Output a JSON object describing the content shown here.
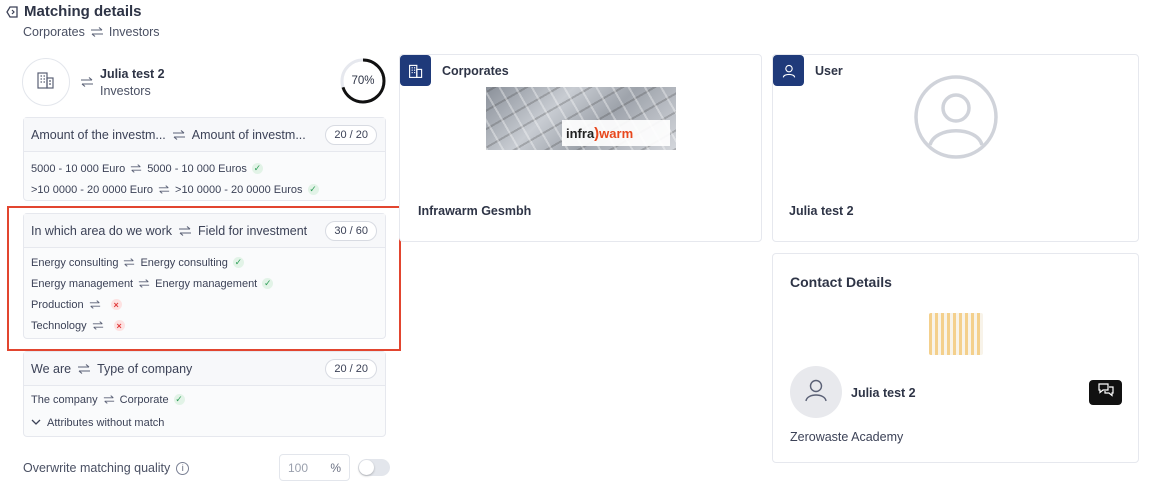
{
  "header": {
    "title": "Matching details",
    "from": "Corporates",
    "to": "Investors"
  },
  "match": {
    "name": "Julia test 2",
    "type": "Investors",
    "score": "70%",
    "score_fraction": 0.7
  },
  "sections": [
    {
      "left": "Amount of the investm...",
      "right": "Amount of investm...",
      "score": "20 / 20",
      "rows": [
        {
          "left": "5000 - 10 000 Euro",
          "right": "5000 - 10 000 Euros",
          "status": "match"
        },
        {
          "left": ">10 0000 - 20 0000 Euro",
          "right": ">10 0000 - 20 0000 Euros",
          "status": "match"
        }
      ]
    },
    {
      "left": "In which area do we work",
      "right": "Field for investment",
      "score": "30 / 60",
      "rows": [
        {
          "left": "Energy consulting",
          "right": "Energy consulting",
          "status": "match"
        },
        {
          "left": "Energy management",
          "right": "Energy management",
          "status": "match"
        },
        {
          "left": "Production",
          "right": "",
          "status": "nomatch"
        },
        {
          "left": "Technology",
          "right": "",
          "status": "nomatch"
        }
      ]
    },
    {
      "left": "We are",
      "right": "Type of company",
      "score": "20 / 20",
      "rows": [
        {
          "left": "The company",
          "right": "Corporate",
          "status": "match"
        }
      ],
      "expander": "Attributes without match"
    }
  ],
  "overwrite": {
    "label": "Overwrite matching quality",
    "placeholder": "100",
    "unit": "%"
  },
  "corporates_panel": {
    "title": "Corporates",
    "name": "Infrawarm Gesmbh",
    "logo_text_a": "infra",
    "logo_text_b": "warm",
    "icon": "building-icon"
  },
  "user_panel": {
    "title": "User",
    "name": "Julia test 2",
    "icon": "user-icon"
  },
  "contact_panel": {
    "title": "Contact Details",
    "person": "Julia test 2",
    "organization": "Zerowaste Academy"
  },
  "colors": {
    "accent": "#1f3a7a",
    "match": "#2f9e58",
    "nomatch": "#e03a3a",
    "highlight": "#e2452f"
  }
}
